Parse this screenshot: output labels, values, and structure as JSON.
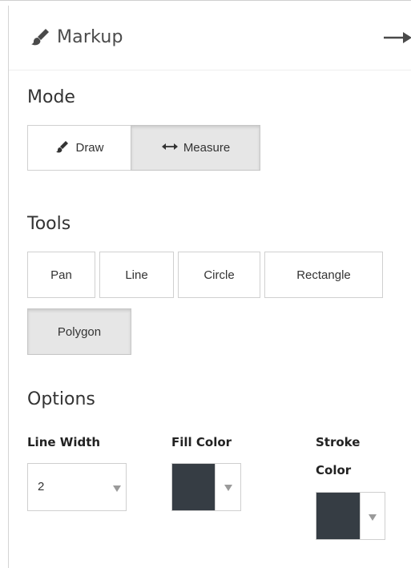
{
  "header": {
    "title": "Markup",
    "icon": "paintbrush-icon",
    "collapse_icon": "arrow-right-icon"
  },
  "mode": {
    "label": "Mode",
    "buttons": [
      {
        "label": "Draw",
        "icon": "paintbrush-icon",
        "active": false
      },
      {
        "label": "Measure",
        "icon": "double-arrow-icon",
        "active": true
      }
    ]
  },
  "tools": {
    "label": "Tools",
    "buttons": [
      {
        "label": "Pan",
        "active": false
      },
      {
        "label": "Line",
        "active": false
      },
      {
        "label": "Circle",
        "active": false
      },
      {
        "label": "Rectangle",
        "active": false
      },
      {
        "label": "Polygon",
        "active": true
      }
    ]
  },
  "options": {
    "label": "Options",
    "line_width": {
      "label": "Line Width",
      "value": "2"
    },
    "fill_color": {
      "label": "Fill Color",
      "value": "#363d44"
    },
    "stroke_color": {
      "label_line1": "Stroke",
      "label_line2": "Color",
      "value": "#363d44"
    }
  },
  "colors": {
    "active_button_bg": "#e6e6e6",
    "border": "#d0d0d0",
    "swatch": "#363d44"
  }
}
